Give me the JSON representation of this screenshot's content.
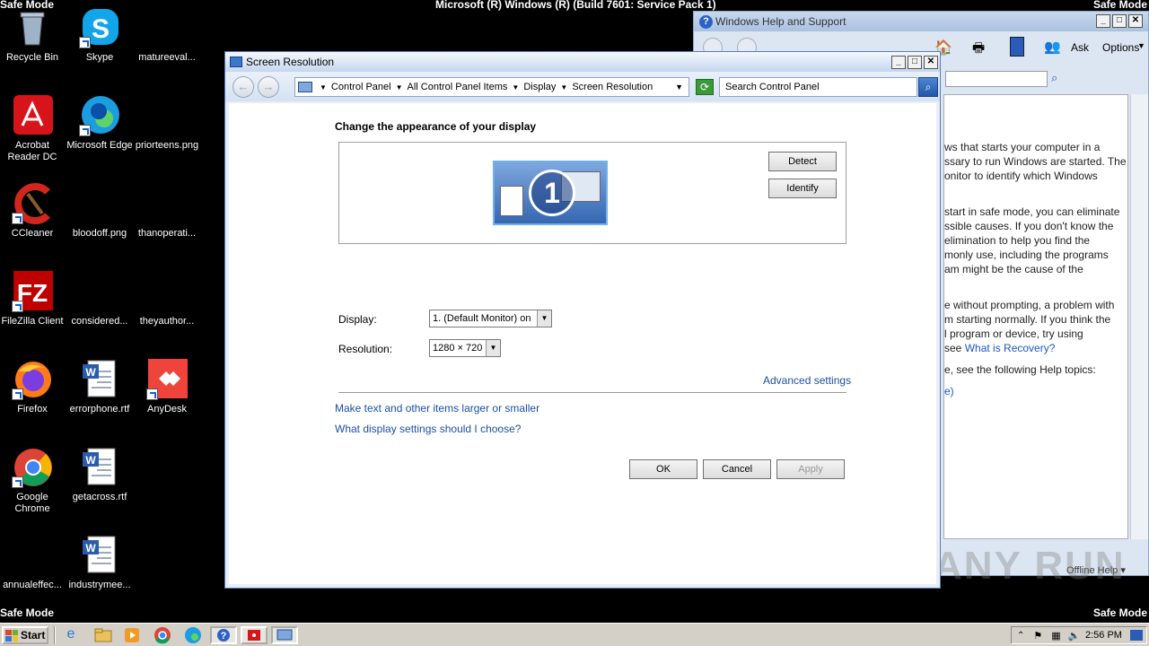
{
  "system": {
    "safe_mode": "Safe Mode",
    "build": "Microsoft (R) Windows (R) (Build 7601: Service Pack 1)"
  },
  "desktop_icons": [
    {
      "label": "Recycle Bin",
      "icon": "recycle-bin-icon"
    },
    {
      "label": "Skype",
      "icon": "skype-icon"
    },
    {
      "label": "matureeval...",
      "icon": "blank-file-icon"
    },
    {
      "label": "Acrobat Reader DC",
      "icon": "acrobat-icon"
    },
    {
      "label": "Microsoft Edge",
      "icon": "edge-icon"
    },
    {
      "label": "priorteens.png",
      "icon": "blank-file-icon"
    },
    {
      "label": "CCleaner",
      "icon": "ccleaner-icon"
    },
    {
      "label": "bloodoff.png",
      "icon": "blank-file-icon"
    },
    {
      "label": "thanoperati...",
      "icon": "blank-file-icon"
    },
    {
      "label": "FileZilla Client",
      "icon": "filezilla-icon"
    },
    {
      "label": "considered...",
      "icon": "blank-file-icon"
    },
    {
      "label": "theyauthor...",
      "icon": "blank-file-icon"
    },
    {
      "label": "Firefox",
      "icon": "firefox-icon"
    },
    {
      "label": "errorphone.rtf",
      "icon": "word-doc-icon"
    },
    {
      "label": "AnyDesk",
      "icon": "anydesk-icon"
    },
    {
      "label": "Google Chrome",
      "icon": "chrome-icon"
    },
    {
      "label": "getacross.rtf",
      "icon": "word-doc-icon"
    },
    {
      "label": "annualeffec...",
      "icon": "blank-file-icon"
    },
    {
      "label": "industrymee...",
      "icon": "word-doc-icon"
    }
  ],
  "help_window": {
    "title": "Windows Help and Support",
    "toolbar": {
      "ask": "Ask",
      "options": "Options"
    },
    "lines": [
      "ws that starts your computer in a",
      "ssary to run Windows are started. The",
      "onitor to identify which Windows",
      "",
      "start in safe mode, you can eliminate",
      "ssible causes. If you don't know the",
      "elimination to help you find the",
      "monly use, including the programs",
      "am might be the cause of the",
      "",
      "e without prompting, a problem with",
      "m starting normally. If you think the",
      "l program or device, try using",
      "see"
    ],
    "recovery_link": "What is Recovery?",
    "see_following": "e, see the following Help topics:",
    "paren_link": "e)",
    "offline_help": "Offline Help"
  },
  "screen_resolution": {
    "title": "Screen Resolution",
    "breadcrumb": [
      "Control Panel",
      "All Control Panel Items",
      "Display",
      "Screen Resolution"
    ],
    "search_placeholder": "Search Control Panel",
    "heading": "Change the appearance of your display",
    "monitor_number": "1",
    "detect_button": "Detect",
    "identify_button": "Identify",
    "display_label": "Display:",
    "display_value": "1. (Default Monitor) on",
    "resolution_label": "Resolution:",
    "resolution_value": "1280 × 720",
    "advanced_settings": "Advanced settings",
    "link_text_size": "Make text and other items larger or smaller",
    "link_what_settings": "What display settings should I choose?",
    "ok_button": "OK",
    "cancel_button": "Cancel",
    "apply_button": "Apply"
  },
  "taskbar": {
    "start": "Start",
    "clock": "2:56 PM"
  },
  "watermark": "ANY RUN"
}
